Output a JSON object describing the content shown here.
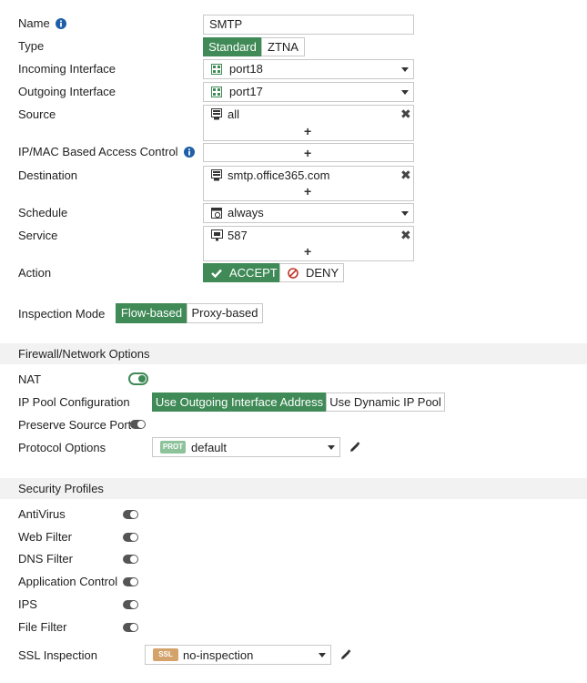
{
  "name": {
    "label": "Name",
    "value": "SMTP"
  },
  "type": {
    "label": "Type",
    "options": [
      "Standard",
      "ZTNA"
    ]
  },
  "incoming": {
    "label": "Incoming Interface",
    "value": "port18"
  },
  "outgoing": {
    "label": "Outgoing Interface",
    "value": "port17"
  },
  "source": {
    "label": "Source",
    "value": "all"
  },
  "ipmac": {
    "label": "IP/MAC Based Access Control"
  },
  "destination": {
    "label": "Destination",
    "value": "smtp.office365.com"
  },
  "schedule": {
    "label": "Schedule",
    "value": "always"
  },
  "service": {
    "label": "Service",
    "value": "587"
  },
  "action": {
    "label": "Action",
    "accept": "ACCEPT",
    "deny": "DENY"
  },
  "inspection": {
    "label": "Inspection Mode",
    "options": [
      "Flow-based",
      "Proxy-based"
    ]
  },
  "firewall": {
    "title": "Firewall/Network Options",
    "nat_label": "NAT",
    "nat_enabled": true,
    "ippool_label": "IP Pool Configuration",
    "ippool_options": [
      "Use Outgoing Interface Address",
      "Use Dynamic IP Pool"
    ],
    "preserve_label": "Preserve Source Port",
    "protocol_label": "Protocol Options",
    "protocol_badge": "PROT",
    "protocol_value": "default"
  },
  "security": {
    "title": "Security Profiles",
    "profiles": [
      "AntiVirus",
      "Web Filter",
      "DNS Filter",
      "Application Control",
      "IPS",
      "File Filter"
    ],
    "ssl_label": "SSL Inspection",
    "ssl_badge": "SSL",
    "ssl_value": "no-inspection"
  },
  "colors": {
    "accent": "#3f8a56",
    "deny": "#c0392b",
    "info": "#1f5fa8",
    "prot_badge": "#8dc29b",
    "ssl_badge": "#d3a36b"
  },
  "plus_symbol": "+",
  "remove_symbol": "✖"
}
